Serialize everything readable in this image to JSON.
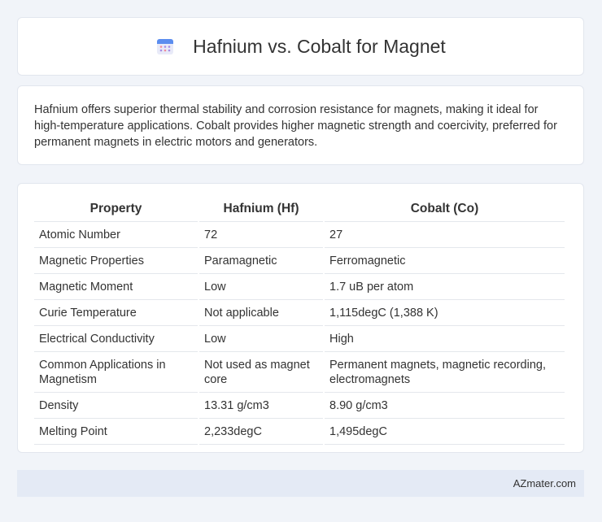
{
  "header": {
    "title": "Hafnium vs. Cobalt for Magnet",
    "icon": "calendar-icon"
  },
  "summary": "Hafnium offers superior thermal stability and corrosion resistance for magnets, making it ideal for high-temperature applications. Cobalt provides higher magnetic strength and coercivity, preferred for permanent magnets in electric motors and generators.",
  "table": {
    "headers": [
      "Property",
      "Hafnium (Hf)",
      "Cobalt (Co)"
    ],
    "rows": [
      [
        "Atomic Number",
        "72",
        "27"
      ],
      [
        "Magnetic Properties",
        "Paramagnetic",
        "Ferromagnetic"
      ],
      [
        "Magnetic Moment",
        "Low",
        "1.7 uB per atom"
      ],
      [
        "Curie Temperature",
        "Not applicable",
        "1,115degC (1,388 K)"
      ],
      [
        "Electrical Conductivity",
        "Low",
        "High"
      ],
      [
        "Common Applications in Magnetism",
        "Not used as magnet core",
        "Permanent magnets, magnetic recording, electromagnets"
      ],
      [
        "Density",
        "13.31 g/cm3",
        "8.90 g/cm3"
      ],
      [
        "Melting Point",
        "2,233degC",
        "1,495degC"
      ]
    ]
  },
  "footer": {
    "site": "AZmater.com"
  }
}
